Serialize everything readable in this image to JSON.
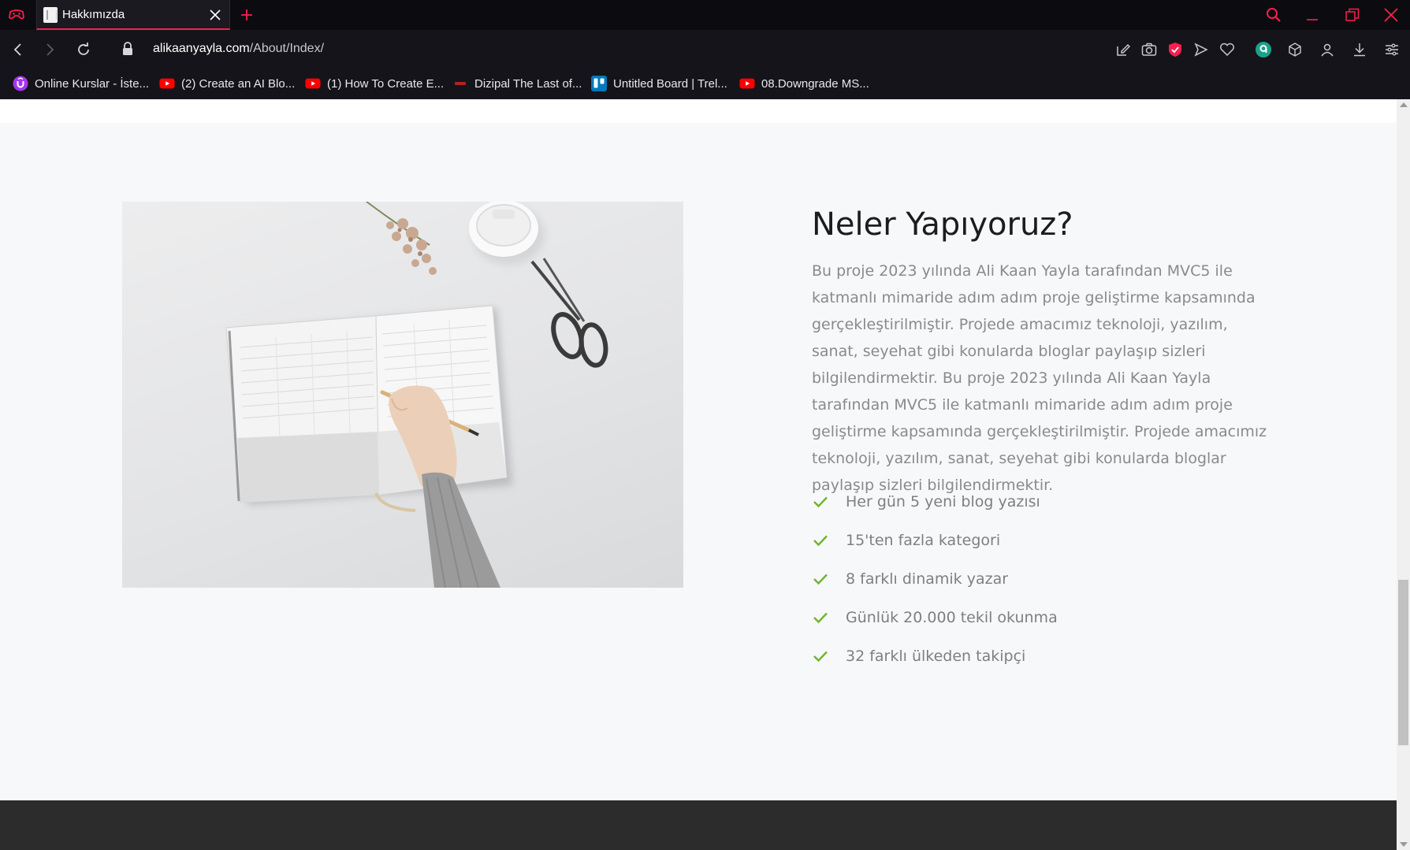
{
  "browser": {
    "tab": {
      "title": "Hakkımızda"
    },
    "address": {
      "host": "alikaanyayla.com",
      "path": "/About/Index/"
    },
    "accent_color": "#fa1e4e",
    "bookmarks": [
      {
        "label": "Online Kurslar - İste...",
        "icon": "udemy-icon",
        "color": "#a435f0"
      },
      {
        "label": "(2) Create an AI Blo...",
        "icon": "youtube-icon",
        "color": "#ff0000"
      },
      {
        "label": "(1) How To Create E...",
        "icon": "youtube-icon",
        "color": "#ff0000"
      },
      {
        "label": "Dizipal The Last of...",
        "icon": "dizipal-icon",
        "color": "#b22222"
      },
      {
        "label": "Untitled Board | Trel...",
        "icon": "trello-icon",
        "color": "#0079bf"
      },
      {
        "label": "08.Downgrade MS...",
        "icon": "youtube-icon",
        "color": "#ff0000"
      }
    ]
  },
  "about": {
    "title": "Neler Yapıyoruz?",
    "paragraph": "Bu proje 2023 yılında Ali Kaan Yayla tarafından MVC5 ile katmanlı mimaride adım adım proje geliştirme kapsamında gerçekleştirilmiştir. Projede amacımız teknoloji, yazılım, sanat, seyehat gibi konularda bloglar paylaşıp sizleri bilgilendirmektir. Bu proje 2023 yılında Ali Kaan Yayla tarafından MVC5 ile katmanlı mimaride adım adım proje geliştirme kapsamında gerçekleştirilmiştir. Projede amacımız teknoloji, yazılım, sanat, seyehat gibi konularda bloglar paylaşıp sizleri bilgilendirmektir.",
    "features": [
      "Her gün 5 yeni blog yazısı",
      "15'ten fazla kategori",
      "8 farklı dinamik yazar",
      "Günlük 20.000 tekil okunma",
      "32 farklı ülkeden takipçi"
    ],
    "check_color": "#6fb52c"
  }
}
